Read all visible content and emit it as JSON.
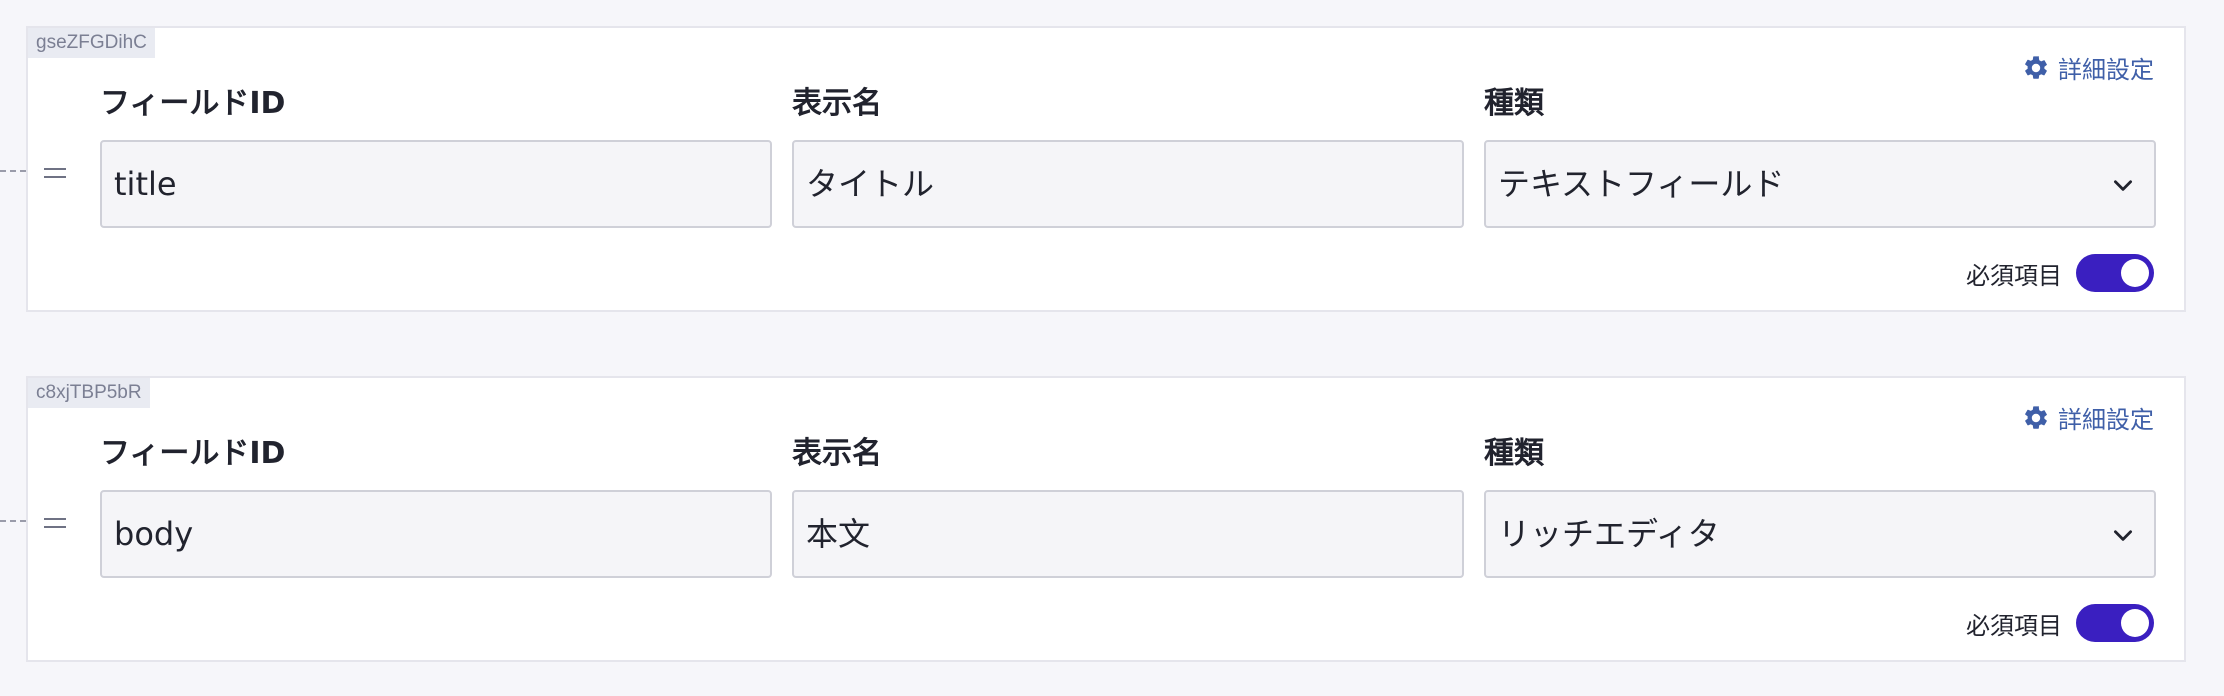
{
  "colors": {
    "background": "#f6f6fa",
    "card": "#ffffff",
    "accent_link": "#3f5fa8",
    "toggle_on": "#3a1fc0",
    "input_bg": "#f5f5f8"
  },
  "fields": [
    {
      "key": "gseZFGDihC",
      "settings_label": "詳細設定",
      "settings_icon": "gear-icon",
      "labels": {
        "id": "フィールドID",
        "display": "表示名",
        "type": "種類"
      },
      "id_value": "title",
      "display_value": "タイトル",
      "type_value": "テキストフィールド",
      "required_label": "必須項目",
      "required": true
    },
    {
      "key": "c8xjTBP5bR",
      "settings_label": "詳細設定",
      "settings_icon": "gear-icon",
      "labels": {
        "id": "フィールドID",
        "display": "表示名",
        "type": "種類"
      },
      "id_value": "body",
      "display_value": "本文",
      "type_value": "リッチエディタ",
      "required_label": "必須項目",
      "required": true
    }
  ]
}
